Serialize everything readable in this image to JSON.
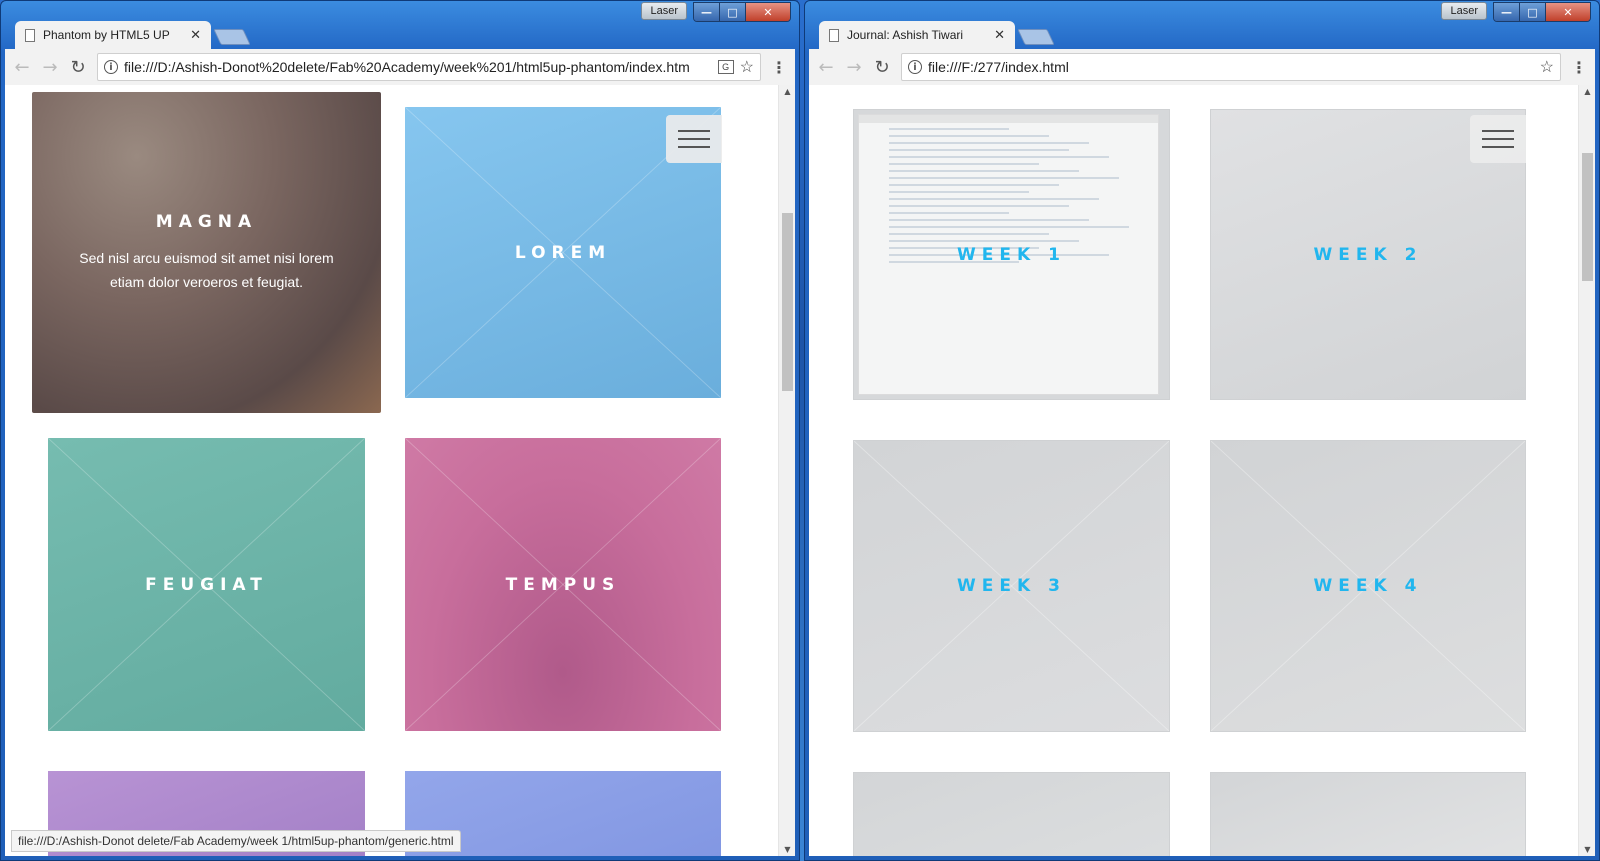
{
  "colors": {
    "accent_week": "#21b6ee",
    "magna": "#6d5a55",
    "lorem": "#78bde8",
    "feugiat": "#6cb5a8",
    "tempus": "#c56b98",
    "purple": "#b08fd0",
    "periwinkle": "#8a9ee6",
    "week_tile": "#d6d8da"
  },
  "left_window": {
    "laser_label": "Laser",
    "tab_title": "Phantom by HTML5 UP",
    "url": "file:///D:/Ashish-Donot%20delete/Fab%20Academy/week%201/html5up-phantom/index.htm",
    "status_url": "file:///D:/Ashish-Donot delete/Fab Academy/week 1/html5up-phantom/generic.html",
    "tiles": [
      {
        "label": "MAGNA",
        "desc": "Sed nisl arcu euismod sit amet nisi lorem etiam dolor veroeros et feugiat."
      },
      {
        "label": "LOREM"
      },
      {
        "label": "FEUGIAT"
      },
      {
        "label": "TEMPUS"
      }
    ]
  },
  "right_window": {
    "laser_label": "Laser",
    "tab_title": "Journal: Ashish Tiwari",
    "url": "file:///F:/277/index.html",
    "tiles": [
      {
        "label": "WEEK 1"
      },
      {
        "label": "WEEK 2"
      },
      {
        "label": "WEEK 3"
      },
      {
        "label": "WEEK 4"
      }
    ]
  },
  "icons": {
    "back": "arrow-left-icon",
    "forward": "arrow-right-icon",
    "reload": "reload-icon",
    "info": "info-icon",
    "translate": "translate-icon",
    "bookmark": "star-icon",
    "menu": "three-dots-icon",
    "hamburger": "hamburger-menu-icon"
  }
}
